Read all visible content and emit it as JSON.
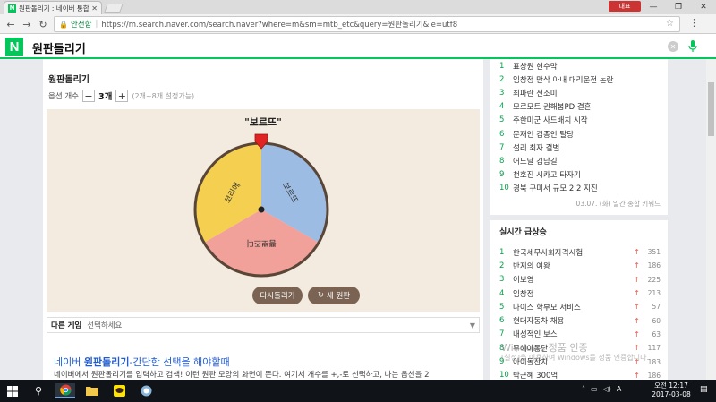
{
  "browser": {
    "tab_title": "원판돌리기 : 네이버 통합검색",
    "tab_favicon": "N",
    "user_badge": "대표",
    "secure_label": "안전함",
    "url": "https://m.search.naver.com/search.naver?where=m&sm=mtb_etc&query=원판돌리기&ie=utf8",
    "icons": {
      "back": "arrow-left-icon",
      "forward": "arrow-right-icon",
      "reload": "reload-icon",
      "lock": "lock-icon",
      "star": "star-icon",
      "menu": "kebab-menu-icon",
      "minimize": "minimize-icon",
      "maximize": "maximize-icon",
      "close": "close-icon"
    }
  },
  "naver": {
    "logo": "N",
    "query": "원판돌리기",
    "brand_color": "#03c75a"
  },
  "roulette": {
    "section_title": "원판돌리기",
    "option_label": "옵션 개수",
    "minus": "−",
    "plus": "+",
    "count": "3개",
    "count_note": "(2개~8개 설정가능)",
    "result": "\"보르뜨\"",
    "segments": [
      {
        "label": "보르뜨",
        "color": "#9cbce4"
      },
      {
        "label": "뽐뽀즈디",
        "color": "#f2a09a"
      },
      {
        "label": "코리에",
        "color": "#f5d050"
      }
    ],
    "retry_label": "다시돌리기",
    "new_label": "새 원판",
    "other_game_label": "다른 게임",
    "other_game_value": "선택하세요"
  },
  "description": {
    "title_prefix": "네이버 ",
    "title_bold": "원판돌리기",
    "title_suffix": "-간단한 선택을 해야할때",
    "body": "네이버에서 원판돌리기를 입력하고 검색! 이런 원판 모양의 화면이 뜬다. 여기서 개수를 +,-로 선택하고, 나는 옵션을 2"
  },
  "ranking": {
    "items": [
      {
        "num": "1",
        "text": "표창원 현수막"
      },
      {
        "num": "2",
        "text": "임창정 만삭 아내 대리운전 논란"
      },
      {
        "num": "3",
        "text": "최파란 전소미"
      },
      {
        "num": "4",
        "text": "모르모트 권해봄PD 결혼"
      },
      {
        "num": "5",
        "text": "주한미군 사드배치 시작"
      },
      {
        "num": "6",
        "text": "문재인 김종인 탈당"
      },
      {
        "num": "7",
        "text": "설리 최자 결별"
      },
      {
        "num": "8",
        "text": "어느날 김남길"
      },
      {
        "num": "9",
        "text": "천호진 시카고 타자기"
      },
      {
        "num": "10",
        "text": "경북 구미서 규모 2.2 지진"
      }
    ],
    "date_note": "03.07. (화) 일간 종합 키워드"
  },
  "trending": {
    "title": "실시간 급상승",
    "items": [
      {
        "num": "1",
        "text": "한국세무사회자격시험",
        "value": "351"
      },
      {
        "num": "2",
        "text": "반지의 여왕",
        "value": "186"
      },
      {
        "num": "3",
        "text": "이보영",
        "value": "225"
      },
      {
        "num": "4",
        "text": "임창정",
        "value": "213"
      },
      {
        "num": "5",
        "text": "나이스 학부모 서비스",
        "value": "57"
      },
      {
        "num": "6",
        "text": "현대자동차 채용",
        "value": "60"
      },
      {
        "num": "7",
        "text": "내성적인 보스",
        "value": "63"
      },
      {
        "num": "8",
        "text": "무혜아동단",
        "value": "117"
      },
      {
        "num": "9",
        "text": "아이돌잔치",
        "value": "183"
      },
      {
        "num": "10",
        "text": "박근혜 300억",
        "value": "186"
      }
    ]
  },
  "watermark": {
    "line1": "Windows 정품 인증",
    "line2": "[설정]을 이용하여 Windows를 정품 인증합니다."
  },
  "taskbar": {
    "lang": "A",
    "time": "오전 12:17",
    "date": "2017-03-08"
  }
}
